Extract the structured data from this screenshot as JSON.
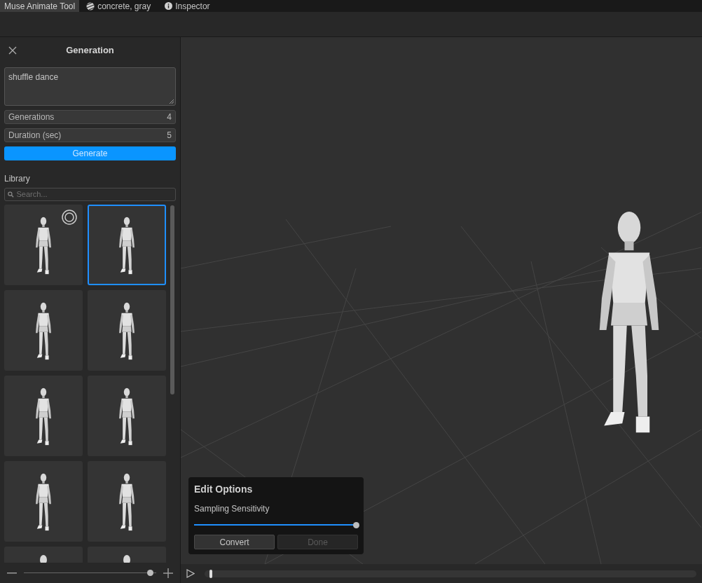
{
  "tabs": [
    {
      "label": "Muse Animate Tool",
      "selected": true,
      "kind": "plain"
    },
    {
      "label": "concrete, gray",
      "selected": false,
      "kind": "material"
    },
    {
      "label": "Inspector",
      "selected": false,
      "kind": "info"
    }
  ],
  "panel": {
    "title": "Generation",
    "prompt": "shuffle dance",
    "fields": [
      {
        "label": "Generations",
        "value": "4"
      },
      {
        "label": "Duration (sec)",
        "value": "5"
      }
    ],
    "generate_button": "Generate",
    "library_label": "Library",
    "search_placeholder": "Search...",
    "thumbnails": [
      {
        "selected": false,
        "active": true
      },
      {
        "selected": true,
        "active": false
      },
      {
        "selected": false,
        "active": false
      },
      {
        "selected": false,
        "active": false
      },
      {
        "selected": false,
        "active": false
      },
      {
        "selected": false,
        "active": false
      },
      {
        "selected": false,
        "active": false
      },
      {
        "selected": false,
        "active": false
      },
      {
        "selected": false,
        "active": false
      },
      {
        "selected": false,
        "active": false
      }
    ],
    "zoom": {
      "level": 0.95
    }
  },
  "edit_options": {
    "title": "Edit Options",
    "slider_label": "Sampling Sensitivity",
    "level": 0.99,
    "buttons": [
      {
        "label": "Convert",
        "disabled": false
      },
      {
        "label": "Done",
        "disabled": true
      }
    ]
  },
  "timeline": {
    "level": 0.01
  }
}
